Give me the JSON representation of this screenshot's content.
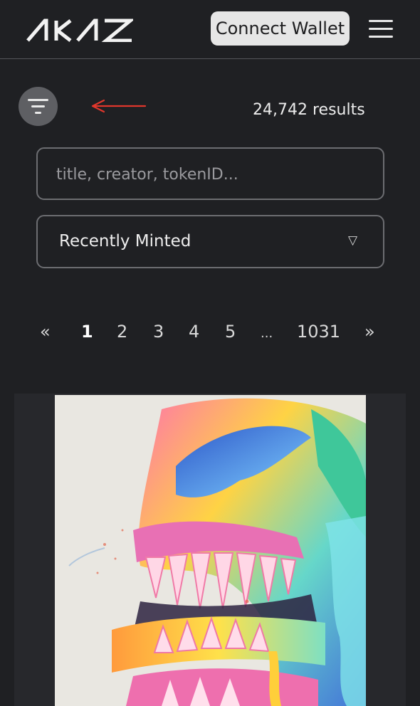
{
  "header": {
    "logo_alt": "AKAS",
    "connect_label": "Connect Wallet"
  },
  "toolbar": {
    "results_text": "24,742 results"
  },
  "search": {
    "placeholder": "title, creator, tokenID...",
    "value": ""
  },
  "sort": {
    "selected": "Recently Minted",
    "caret": "▽"
  },
  "pagination": {
    "first": "«",
    "pages": [
      "1",
      "2",
      "3",
      "4",
      "5"
    ],
    "ellipsis": "...",
    "last_page": "1031",
    "last": "»",
    "current": "1"
  },
  "colors": {
    "background": "#1f2023",
    "button_bg": "#e6e6e6",
    "filter_bg": "#5e5f63",
    "arrow_red": "#e0372c"
  }
}
